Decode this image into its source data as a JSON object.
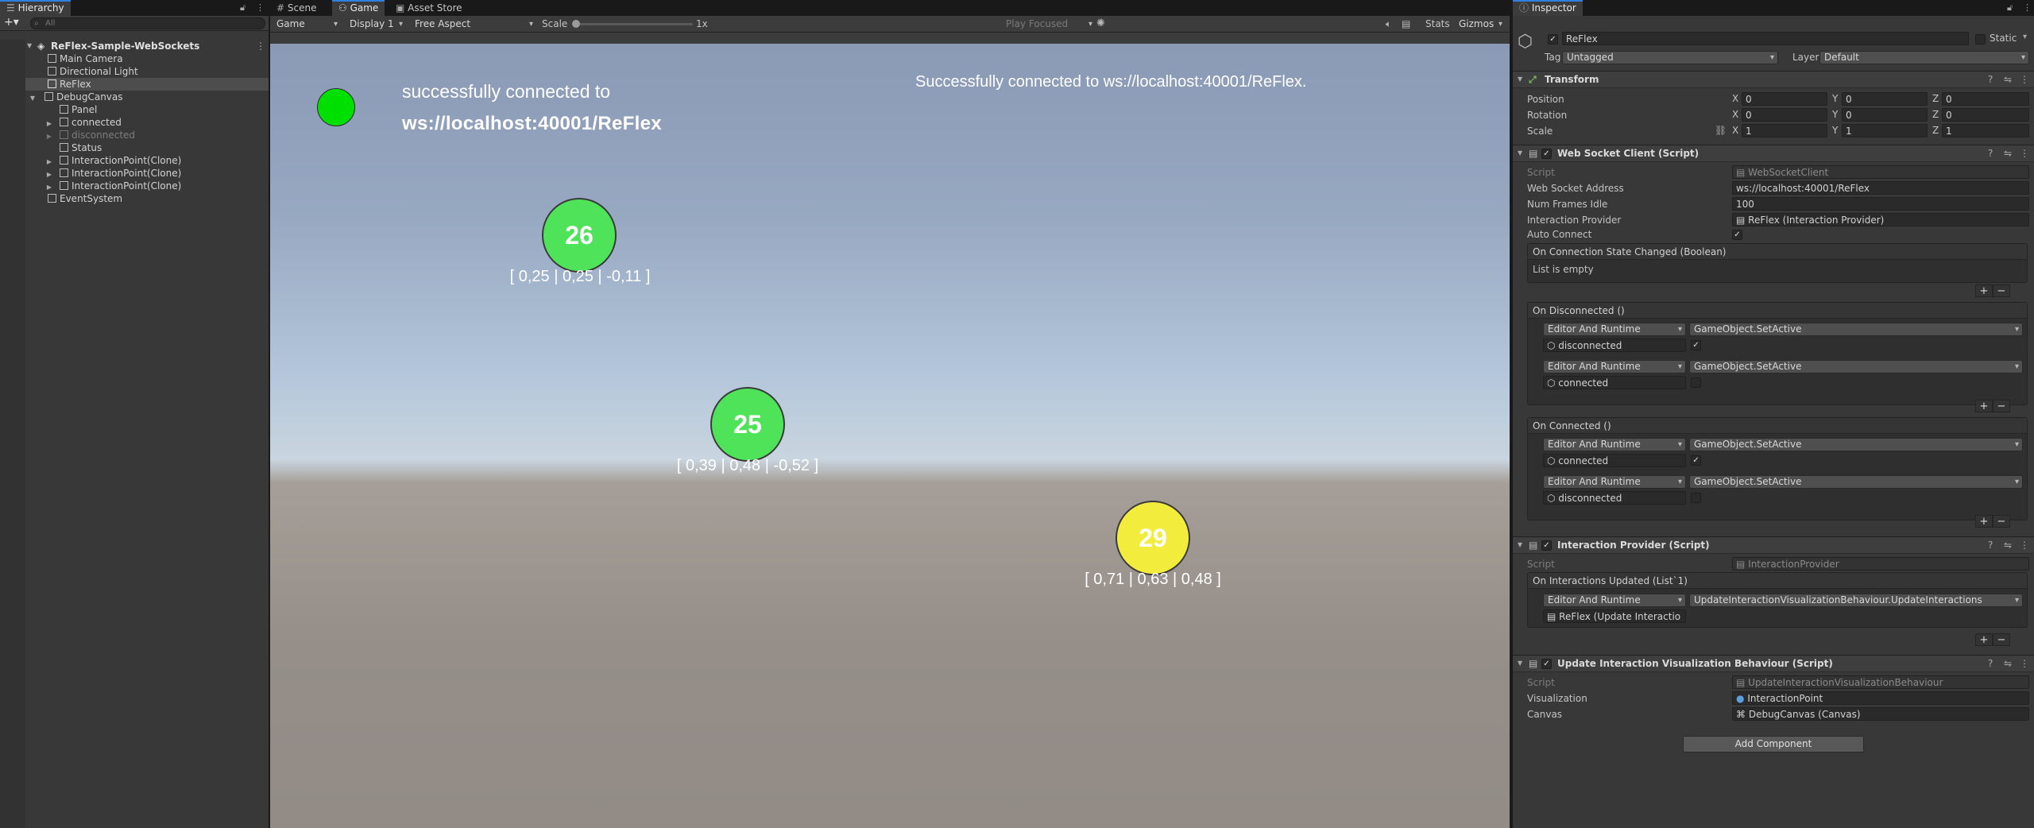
{
  "hierarchy": {
    "tab_label": "Hierarchy",
    "search_placeholder": "All",
    "scene_name": "ReFlex-Sample-WebSockets",
    "items": [
      {
        "label": "Main Camera"
      },
      {
        "label": "Directional Light"
      },
      {
        "label": "ReFlex"
      },
      {
        "label": "DebugCanvas"
      },
      {
        "label": "Panel"
      },
      {
        "label": "connected"
      },
      {
        "label": "disconnected"
      },
      {
        "label": "Status"
      },
      {
        "label": "InteractionPoint(Clone)"
      },
      {
        "label": "InteractionPoint(Clone)"
      },
      {
        "label": "InteractionPoint(Clone)"
      },
      {
        "label": "EventSystem"
      }
    ]
  },
  "center_tabs": {
    "scene": "Scene",
    "game": "Game",
    "asset_store": "Asset Store"
  },
  "game_toolbar": {
    "mode": "Game",
    "display": "Display 1",
    "aspect": "Free Aspect",
    "scale_label": "Scale",
    "scale_value": "1x",
    "play_focused": "Play Focused",
    "stats": "Stats",
    "gizmos": "Gizmos"
  },
  "game_view": {
    "status_text_line1": "successfully connected to",
    "status_text_line2": "ws://localhost:40001/ReFlex",
    "log_text": "Successfully connected to ws://localhost:40001/ReFlex.",
    "status_indicator_color": "#00e000",
    "points": [
      {
        "id": "26",
        "coords": "[ 0,25 | 0,25 | -0,11 ]",
        "color": "#4fe35a"
      },
      {
        "id": "25",
        "coords": "[ 0,39 | 0,48 | -0,52 ]",
        "color": "#4fe35a"
      },
      {
        "id": "29",
        "coords": "[ 0,71 | 0,63 | 0,48 ]",
        "color": "#f2ec3c"
      }
    ]
  },
  "inspector": {
    "tab_label": "Inspector",
    "object_name": "ReFlex",
    "static_label": "Static",
    "tag_label": "Tag",
    "tag_value": "Untagged",
    "layer_label": "Layer",
    "layer_value": "Default",
    "transform": {
      "title": "Transform",
      "position_label": "Position",
      "rotation_label": "Rotation",
      "scale_label": "Scale",
      "axis_x": "X",
      "axis_y": "Y",
      "axis_z": "Z",
      "position": [
        "0",
        "0",
        "0"
      ],
      "rotation": [
        "0",
        "0",
        "0"
      ],
      "scale": [
        "1",
        "1",
        "1"
      ]
    },
    "websocket_client": {
      "title": "Web Socket Client (Script)",
      "script_label": "Script",
      "script_value": "WebSocketClient",
      "address_label": "Web Socket Address",
      "address_value": "ws://localhost:40001/ReFlex",
      "frames_label": "Num Frames Idle",
      "frames_value": "100",
      "provider_label": "Interaction Provider",
      "provider_value": "ReFlex (Interaction Provider)",
      "auto_connect_label": "Auto Connect",
      "state_changed_header": "On Connection State Changed (Boolean)",
      "list_empty": "List is empty",
      "on_disconnected_header": "On Disconnected ()",
      "on_connected_header": "On Connected ()",
      "runtime_option": "Editor And Runtime",
      "method": "GameObject.SetActive",
      "obj_disconnected": "disconnected",
      "obj_connected": "connected"
    },
    "interaction_provider": {
      "title": "Interaction Provider (Script)",
      "script_label": "Script",
      "script_value": "InteractionProvider",
      "event_header": "On Interactions Updated (List`1)",
      "runtime_option": "Editor And Runtime",
      "method": "UpdateInteractionVisualizationBehaviour.UpdateInteractions",
      "target": "ReFlex (Update Interactio"
    },
    "update_visualization": {
      "title": "Update Interaction Visualization Behaviour (Script)",
      "script_label": "Script",
      "script_value": "UpdateInteractionVisualizationBehaviour",
      "visualization_label": "Visualization",
      "visualization_value": "InteractionPoint",
      "canvas_label": "Canvas",
      "canvas_value": "DebugCanvas (Canvas)"
    },
    "add_component": "Add Component"
  }
}
